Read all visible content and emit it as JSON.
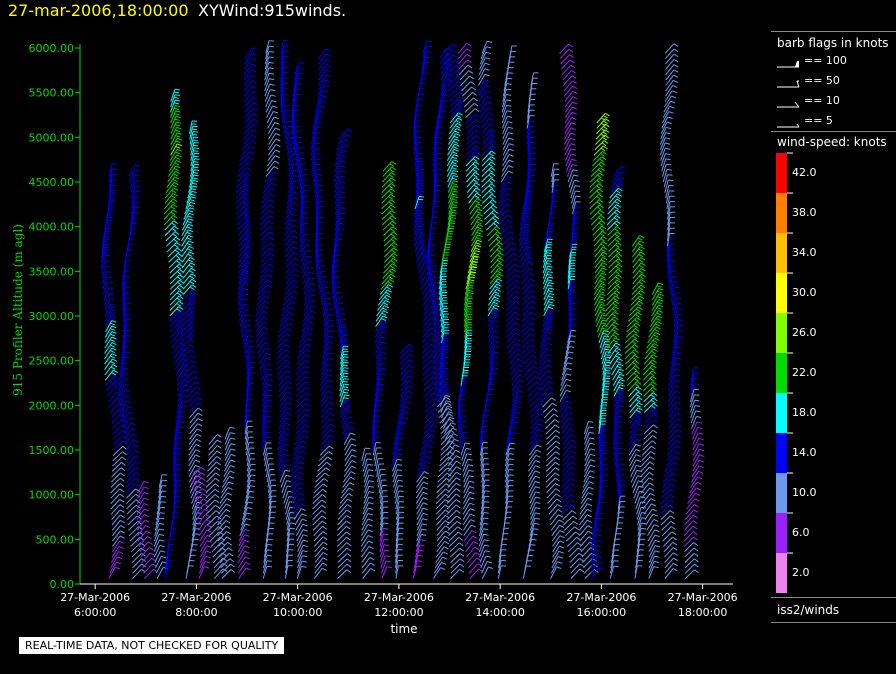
{
  "header": {
    "time": "27-mar-2006,18:00:00",
    "product": "XYWind:915winds."
  },
  "chart_data": {
    "type": "wind-barb profile time series",
    "ylabel": "915 Profiler Altitude (m agl)",
    "xlabel": "time",
    "ylim": [
      0,
      6000
    ],
    "y_ticks": [
      "0.00",
      "500.00",
      "1000.00",
      "1500.00",
      "2000.00",
      "2500.00",
      "3000.00",
      "3500.00",
      "4000.00",
      "4500.00",
      "5000.00",
      "5500.00",
      "6000.00"
    ],
    "x_ticks": [
      {
        "date": "27-Mar-2006",
        "time": "6:00:00"
      },
      {
        "date": "27-Mar-2006",
        "time": "8:00:00"
      },
      {
        "date": "27-Mar-2006",
        "time": "10:00:00"
      },
      {
        "date": "27-Mar-2006",
        "time": "12:00:00"
      },
      {
        "date": "27-Mar-2006",
        "time": "14:00:00"
      },
      {
        "date": "27-Mar-2006",
        "time": "16:00:00"
      },
      {
        "date": "27-Mar-2006",
        "time": "18:00:00"
      }
    ],
    "xlim_hours": [
      5.7,
      18.6
    ],
    "profiles": [
      {
        "time": 6.25,
        "top": 4600,
        "speeds": [
          [
            0,
            6
          ],
          [
            400,
            8
          ],
          [
            900,
            10
          ],
          [
            1500,
            12
          ],
          [
            2000,
            14
          ],
          [
            2500,
            18
          ],
          [
            3200,
            14
          ],
          [
            4000,
            16
          ],
          [
            4600,
            14
          ]
        ]
      },
      {
        "time": 6.6,
        "top": 4600,
        "speeds": [
          [
            0,
            10
          ],
          [
            1000,
            12
          ],
          [
            3400,
            14
          ],
          [
            4600,
            14
          ]
        ]
      },
      {
        "time": 6.9,
        "top": 1050,
        "speeds": [
          [
            0,
            6
          ],
          [
            1050,
            8
          ]
        ]
      },
      {
        "time": 7.3,
        "top": 1100,
        "speeds": [
          [
            0,
            10
          ],
          [
            1100,
            10
          ]
        ]
      },
      {
        "time": 7.5,
        "top": 5450,
        "speeds": [
          [
            0,
            12
          ],
          [
            2000,
            12
          ],
          [
            4000,
            20
          ],
          [
            4800,
            24
          ],
          [
            5450,
            18
          ]
        ]
      },
      {
        "time": 7.8,
        "top": 5050,
        "speeds": [
          [
            0,
            10
          ],
          [
            1700,
            10
          ],
          [
            2100,
            14
          ],
          [
            3200,
            16
          ],
          [
            4000,
            20
          ],
          [
            5050,
            18
          ]
        ]
      },
      {
        "time": 7.95,
        "top": 1250,
        "speeds": [
          [
            0,
            6
          ],
          [
            1250,
            8
          ]
        ]
      },
      {
        "time": 8.3,
        "top": 1600,
        "speeds": [
          [
            0,
            8
          ],
          [
            1600,
            10
          ]
        ]
      },
      {
        "time": 8.55,
        "top": 1650,
        "speeds": [
          [
            0,
            10
          ],
          [
            1650,
            12
          ]
        ]
      },
      {
        "time": 8.9,
        "top": 5900,
        "speeds": [
          [
            0,
            6
          ],
          [
            1000,
            10
          ],
          [
            2400,
            14
          ],
          [
            4100,
            16
          ],
          [
            5900,
            12
          ]
        ]
      },
      {
        "time": 9.3,
        "top": 5950,
        "speeds": [
          [
            0,
            8
          ],
          [
            1500,
            12
          ],
          [
            3000,
            14
          ],
          [
            4500,
            12
          ],
          [
            5950,
            10
          ]
        ]
      },
      {
        "time": 9.7,
        "top": 5950,
        "speeds": [
          [
            0,
            10
          ],
          [
            1200,
            12
          ],
          [
            3000,
            14
          ],
          [
            5950,
            12
          ]
        ]
      },
      {
        "time": 10.0,
        "top": 5700,
        "speeds": [
          [
            0,
            10
          ],
          [
            1500,
            14
          ],
          [
            2700,
            14
          ],
          [
            4200,
            12
          ],
          [
            5700,
            14
          ]
        ]
      },
      {
        "time": 10.4,
        "top": 5900,
        "speeds": [
          [
            0,
            10
          ],
          [
            1500,
            12
          ],
          [
            3000,
            14
          ],
          [
            5900,
            14
          ]
        ]
      },
      {
        "time": 10.8,
        "top": 5000,
        "speeds": [
          [
            0,
            8
          ],
          [
            1400,
            10
          ],
          [
            2100,
            18
          ],
          [
            3000,
            14
          ],
          [
            5000,
            14
          ]
        ]
      },
      {
        "time": 11.2,
        "top": 1400,
        "speeds": [
          [
            0,
            8
          ],
          [
            1400,
            10
          ]
        ]
      },
      {
        "time": 11.6,
        "top": 4650,
        "speeds": [
          [
            0,
            6
          ],
          [
            1500,
            12
          ],
          [
            2600,
            14
          ],
          [
            3500,
            22
          ],
          [
            4650,
            22
          ]
        ]
      },
      {
        "time": 12.0,
        "top": 2600,
        "speeds": [
          [
            0,
            10
          ],
          [
            2600,
            14
          ]
        ]
      },
      {
        "time": 12.4,
        "top": 5950,
        "speeds": [
          [
            0,
            6
          ],
          [
            1200,
            12
          ],
          [
            2800,
            14
          ],
          [
            4200,
            16
          ],
          [
            5950,
            12
          ]
        ]
      },
      {
        "time": 12.7,
        "top": 5900,
        "speeds": [
          [
            0,
            8
          ],
          [
            2000,
            12
          ],
          [
            3500,
            14
          ],
          [
            5900,
            14
          ]
        ]
      },
      {
        "time": 12.9,
        "top": 5950,
        "speeds": [
          [
            0,
            10
          ],
          [
            2000,
            12
          ],
          [
            3000,
            18
          ],
          [
            4000,
            22
          ],
          [
            5950,
            12
          ]
        ]
      },
      {
        "time": 13.3,
        "top": 5950,
        "speeds": [
          [
            0,
            6
          ],
          [
            1500,
            12
          ],
          [
            2500,
            18
          ],
          [
            3500,
            26
          ],
          [
            5950,
            6
          ]
        ]
      },
      {
        "time": 13.7,
        "top": 5950,
        "speeds": [
          [
            0,
            10
          ],
          [
            1500,
            12
          ],
          [
            2800,
            14
          ],
          [
            3500,
            22
          ],
          [
            4400,
            18
          ],
          [
            5950,
            10
          ]
        ]
      },
      {
        "time": 14.1,
        "top": 5900,
        "speeds": [
          [
            0,
            10
          ],
          [
            1500,
            12
          ],
          [
            3000,
            14
          ],
          [
            5900,
            10
          ]
        ]
      },
      {
        "time": 14.5,
        "top": 5600,
        "speeds": [
          [
            0,
            8
          ],
          [
            1500,
            12
          ],
          [
            3000,
            14
          ],
          [
            4000,
            16
          ],
          [
            5600,
            10
          ]
        ]
      },
      {
        "time": 14.9,
        "top": 4600,
        "speeds": [
          [
            0,
            8
          ],
          [
            1500,
            10
          ],
          [
            2500,
            14
          ],
          [
            3500,
            18
          ],
          [
            4600,
            10
          ]
        ]
      },
      {
        "time": 15.3,
        "top": 5950,
        "speeds": [
          [
            0,
            10
          ],
          [
            1500,
            14
          ],
          [
            2500,
            10
          ],
          [
            3500,
            18
          ],
          [
            4500,
            8
          ],
          [
            5950,
            6
          ]
        ]
      },
      {
        "time": 15.7,
        "top": 1700,
        "speeds": [
          [
            0,
            12
          ],
          [
            1700,
            10
          ]
        ]
      },
      {
        "time": 15.9,
        "top": 5200,
        "speeds": [
          [
            0,
            12
          ],
          [
            1000,
            14
          ],
          [
            2300,
            18
          ],
          [
            3200,
            22
          ],
          [
            4300,
            22
          ],
          [
            5200,
            26
          ]
        ]
      },
      {
        "time": 16.2,
        "top": 4600,
        "speeds": [
          [
            0,
            10
          ],
          [
            1800,
            14
          ],
          [
            2600,
            20
          ],
          [
            3700,
            22
          ],
          [
            4600,
            14
          ]
        ]
      },
      {
        "time": 16.6,
        "top": 3800,
        "speeds": [
          [
            0,
            10
          ],
          [
            1500,
            12
          ],
          [
            2300,
            22
          ],
          [
            3800,
            22
          ]
        ]
      },
      {
        "time": 16.9,
        "top": 3250,
        "speeds": [
          [
            0,
            10
          ],
          [
            1500,
            8
          ],
          [
            2200,
            22
          ],
          [
            3250,
            24
          ]
        ]
      },
      {
        "time": 17.3,
        "top": 5950,
        "speeds": [
          [
            0,
            10
          ],
          [
            1500,
            14
          ],
          [
            3000,
            14
          ],
          [
            4500,
            10
          ],
          [
            5950,
            10
          ]
        ]
      },
      {
        "time": 17.7,
        "top": 2300,
        "speeds": [
          [
            0,
            10
          ],
          [
            800,
            6
          ],
          [
            1500,
            6
          ],
          [
            2300,
            14
          ]
        ]
      }
    ]
  },
  "legend": {
    "title": "barb flags in knots",
    "flags": [
      "== 100",
      "== 50",
      "== 10",
      "== 5"
    ],
    "colorscale_title": "wind-speed: knots",
    "colorscale": [
      {
        "label": "42.0",
        "color": "#ff0000"
      },
      {
        "label": "38.0",
        "color": "#ff7f00"
      },
      {
        "label": "34.0",
        "color": "#ffbf00"
      },
      {
        "label": "30.0",
        "color": "#ffff00"
      },
      {
        "label": "26.0",
        "color": "#7fff00"
      },
      {
        "label": "22.0",
        "color": "#00dd00"
      },
      {
        "label": "18.0",
        "color": "#00ffff"
      },
      {
        "label": "14.0",
        "color": "#0000ff"
      },
      {
        "label": "10.0",
        "color": "#6a9aef"
      },
      {
        "label": "6.0",
        "color": "#9a20ff"
      },
      {
        "label": "2.0",
        "color": "#ee82ee"
      }
    ],
    "source": "iss2/winds"
  },
  "notice": "REAL-TIME DATA, NOT CHECKED FOR QUALITY",
  "colors": {
    "axis": "#00dd00",
    "time": "#ffff00"
  }
}
